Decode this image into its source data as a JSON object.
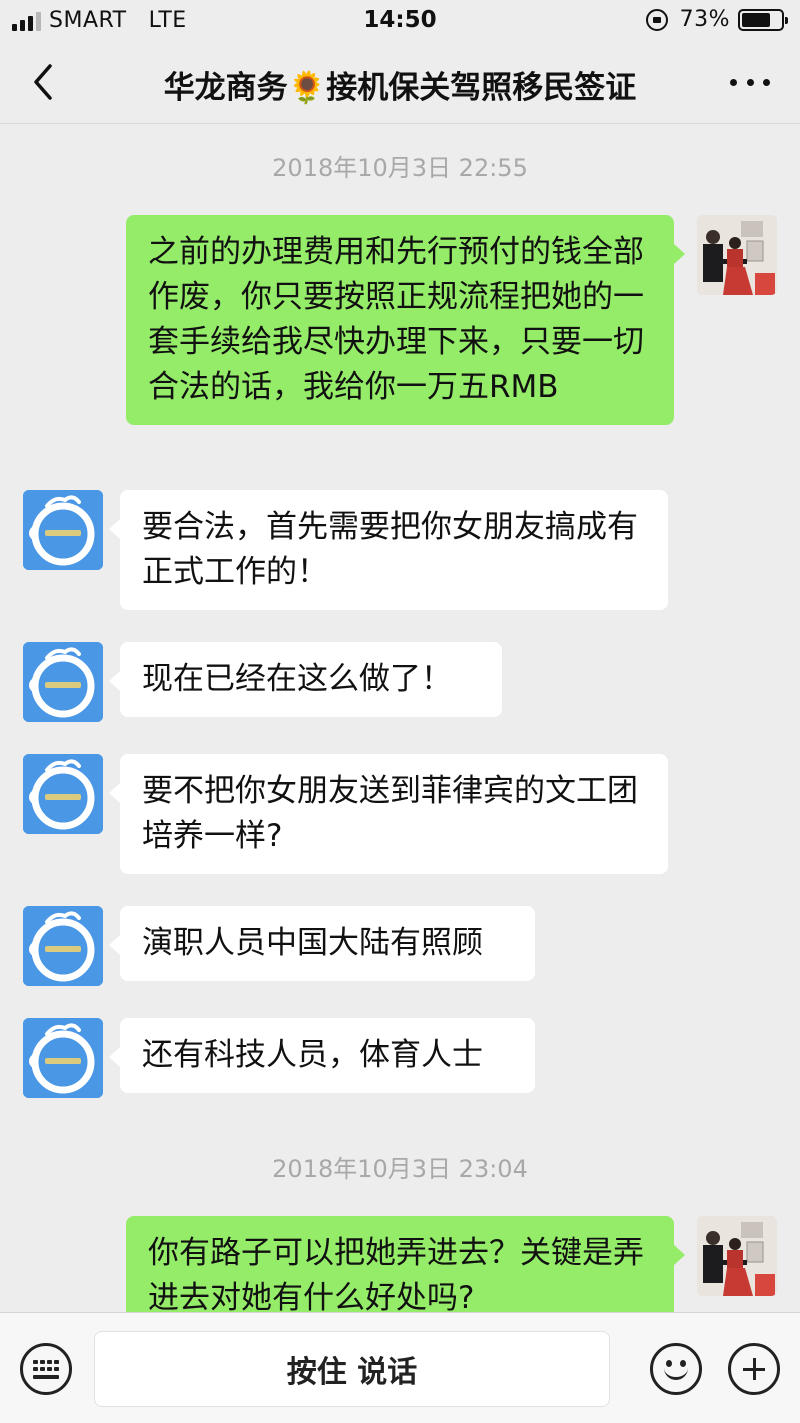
{
  "status_bar": {
    "carrier": "SMART",
    "network": "LTE",
    "time": "14:50",
    "battery_percent": "73%",
    "battery_level": 0.73,
    "icons": [
      "signal-icon",
      "rotation-lock-icon",
      "battery-icon"
    ]
  },
  "header": {
    "title": "华龙商务🌻接机保关驾照移民签证",
    "icons": [
      "back-chevron-icon",
      "more-dots-icon"
    ]
  },
  "chat": {
    "timestamps": [
      "2018年10月3日 22:55",
      "2018年10月3日 23:04"
    ],
    "messages": [
      {
        "sender": "me",
        "text": "之前的办理费用和先行预付的钱全部作废，你只要按照正规流程把她的一套手续给我尽快办理下来，只要一切合法的话，我给你一万五RMB"
      },
      {
        "sender": "other",
        "text": "要合法，首先需要把你女朋友搞成有正式工作的！"
      },
      {
        "sender": "other",
        "text": "现在已经在这么做了！"
      },
      {
        "sender": "other",
        "text": "要不把你女朋友送到菲律宾的文工团培养一样?"
      },
      {
        "sender": "other",
        "text": "演职人员中国大陆有照顾"
      },
      {
        "sender": "other",
        "text": "还有科技人员，体育人士"
      },
      {
        "sender": "me",
        "text": "你有路子可以把她弄进去？关键是弄进去对她有什么好处吗?"
      }
    ]
  },
  "input_bar": {
    "hold_to_talk": "按住 说话",
    "icons": [
      "keyboard-icon",
      "emoji-icon",
      "plus-icon"
    ]
  },
  "colors": {
    "background": "#ededed",
    "outgoing_bubble": "#95ec69",
    "incoming_bubble": "#ffffff",
    "brand_avatar": "#4a97e6",
    "timestamp_text": "#a8a8a8"
  }
}
